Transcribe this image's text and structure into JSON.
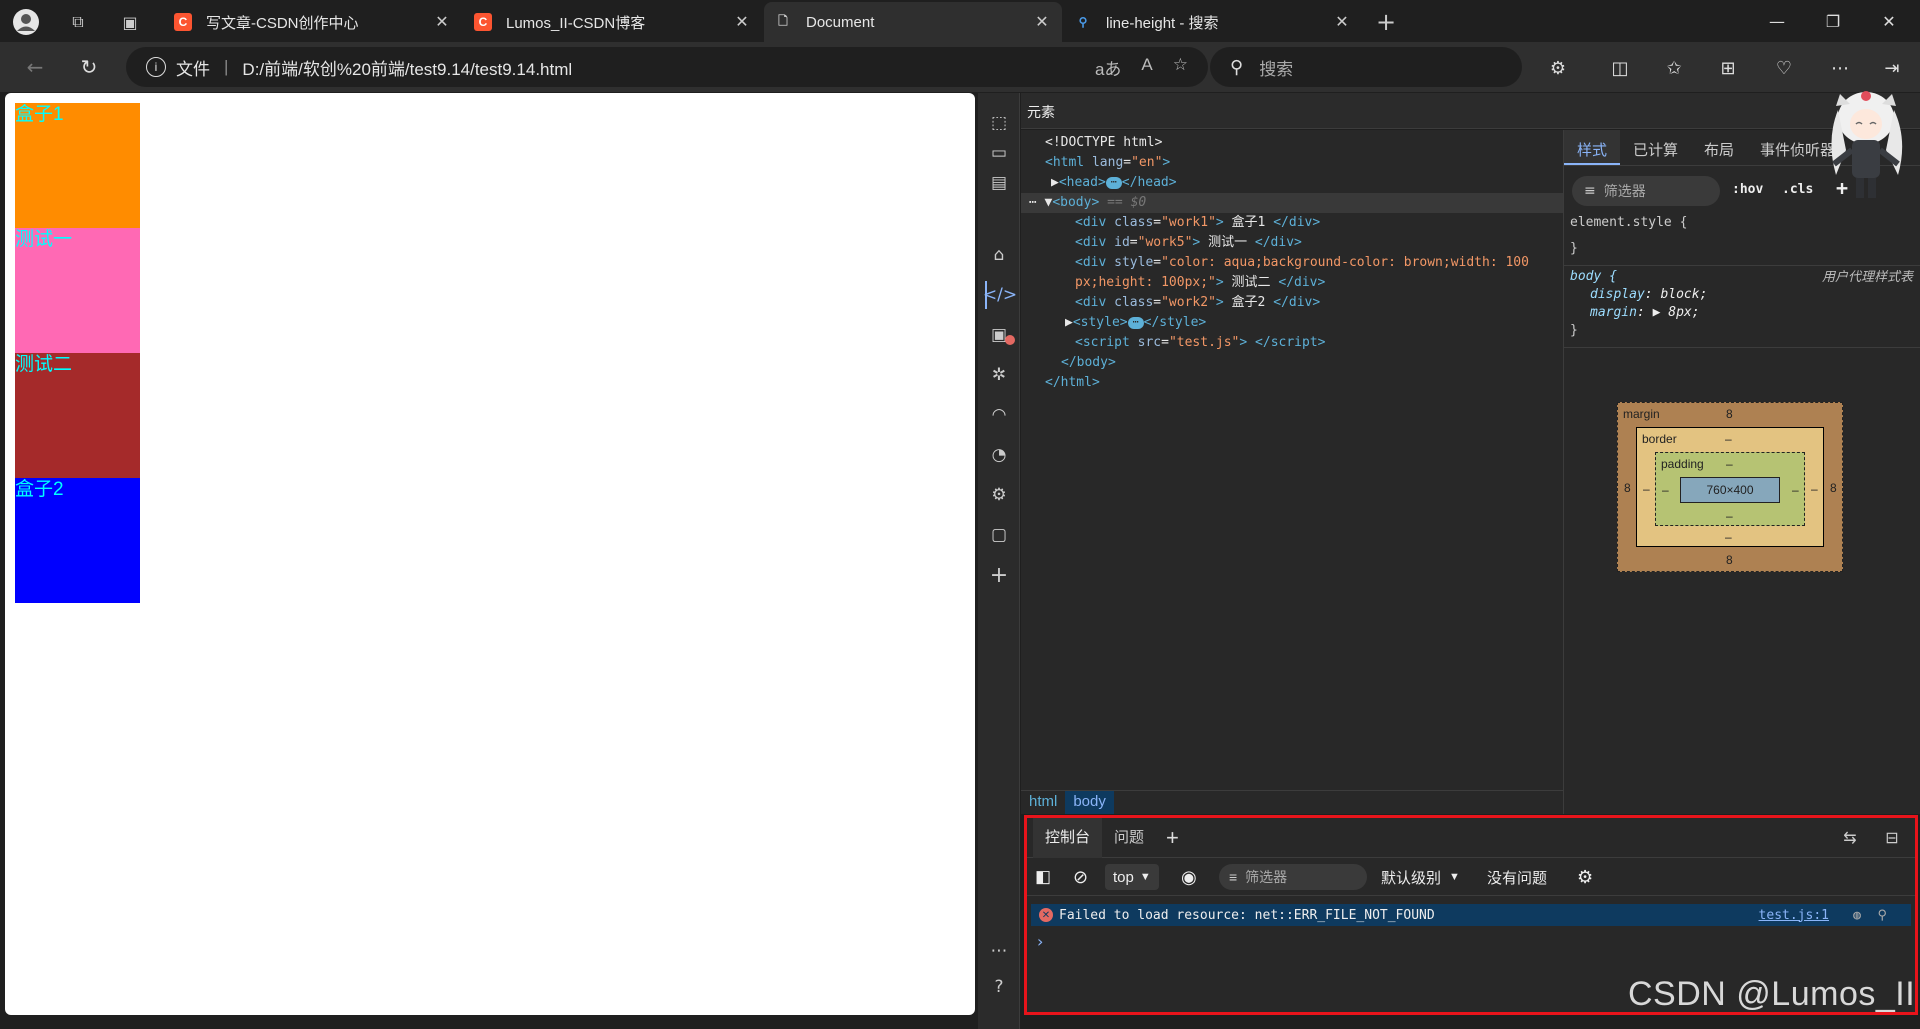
{
  "tabs": [
    {
      "title": "写文章-CSDN创作中心",
      "favicon": "C",
      "favicon_color": "#fc5531",
      "active": false
    },
    {
      "title": "Lumos_II-CSDN博客",
      "favicon": "C",
      "favicon_color": "#fc5531",
      "active": false
    },
    {
      "title": "Document",
      "favicon": "page-icon",
      "active": true
    },
    {
      "title": "line-height - 搜索",
      "favicon": "search-icon",
      "active": false
    }
  ],
  "address": {
    "label": "文件",
    "url": "D:/前端/软创%20前端/test9.14/test9.14.html"
  },
  "search": {
    "placeholder": "搜索"
  },
  "page": {
    "boxes": [
      {
        "text": "盒子1",
        "bg": "#ff8c00"
      },
      {
        "text": "测试一",
        "bg": "#ff69b4"
      },
      {
        "text": "测试二",
        "bg": "#a52a2a"
      },
      {
        "text": "盒子2",
        "bg": "#0000ff"
      }
    ]
  },
  "elements": {
    "title": "元素",
    "dom": {
      "doctype": "<!DOCTYPE html>",
      "html_open": "<html lang=\"en\">",
      "html_tag": "<html",
      "html_attr": "lang",
      "html_val": "\"en\"",
      "head": "<head>",
      "head_close": "</head>",
      "body_open": "<body>",
      "eq": "== $0",
      "line1": {
        "cls": "\"work1\"",
        "text": " 盒子1 "
      },
      "line2": {
        "id": "\"work5\"",
        "text": " 测试一 "
      },
      "line3": {
        "style": "\"color: aqua;background-color: brown;width: 100",
        "style2": "px;height: 100px;\"",
        "text": " 测试二 "
      },
      "line4": {
        "cls": "\"work2\"",
        "text": " 盒子2 "
      },
      "style_open": "<style>",
      "style_close": "</style>",
      "script": {
        "src": "\"test.js\""
      },
      "body_close": "</body>",
      "html_close": "</html>"
    },
    "breadcrumbs": [
      "html",
      "body"
    ]
  },
  "styles": {
    "tabs": [
      "样式",
      "已计算",
      "布局",
      "事件侦听器"
    ],
    "filter_placeholder": "筛选器",
    "hov": ":hov",
    "cls": ".cls",
    "element_style": "element.style {",
    "close_brace": "}",
    "body_selector": "body {",
    "ua_label": "用户代理样式表",
    "props": [
      {
        "name": "display",
        "value": "block;"
      },
      {
        "name": "margin",
        "value": "8px;"
      }
    ],
    "box_model": {
      "margin_label": "margin",
      "margin_top": "8",
      "margin_left": "8",
      "margin_right": "8",
      "margin_bottom": "8",
      "border_label": "border",
      "border_value": "–",
      "padding_label": "padding",
      "padding_value": "–",
      "content": "760×400"
    }
  },
  "console": {
    "tabs": [
      "控制台",
      "问题"
    ],
    "context": "top",
    "filter_placeholder": "筛选器",
    "level": "默认级别",
    "issues": "没有问题",
    "message": "Failed to load resource: net::ERR_FILE_NOT_FOUND",
    "source": "test.js:1",
    "prompt": "›"
  },
  "watermark": "CSDN @Lumos_II",
  "colors": {
    "accent": "#8ab4f8",
    "highlight_border": "#e8141b",
    "error": "#e46962"
  }
}
